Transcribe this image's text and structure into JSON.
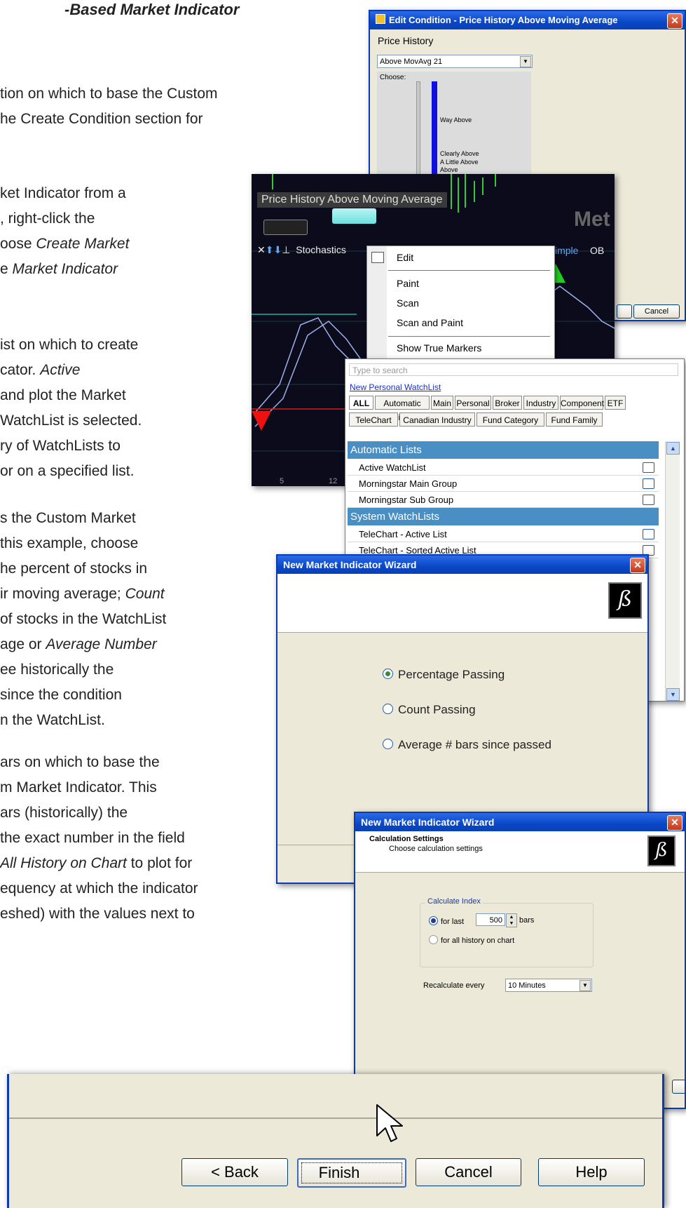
{
  "doc": {
    "heading": "-Based Market Indicator",
    "p1": [
      "tion on which to base the Custom",
      "he Create Condition section for"
    ],
    "p2": [
      {
        "a": "ket Indicator from a"
      },
      {
        "a": ", right-click the"
      },
      {
        "a": "oose ",
        "i": "Create Market"
      },
      {
        "a": "e ",
        "i": "Market Indicator"
      }
    ],
    "p3": [
      {
        "a": "ist on which to create"
      },
      {
        "a": "cator.  ",
        "i": "Active"
      },
      {
        "a": "and plot the Market"
      },
      {
        "a": "WatchList is selected."
      },
      {
        "a": "ry of WatchLists to"
      },
      {
        "a": "or on a specified list."
      }
    ],
    "p4": [
      {
        "a": "s the Custom Market"
      },
      {
        "a": " this example, choose"
      },
      {
        "a": "he percent of stocks in"
      },
      {
        "a": "ir moving average; ",
        "i": "Count"
      },
      {
        "a": "of stocks in the WatchList"
      },
      {
        "a": "age or ",
        "i": "Average Number"
      },
      {
        "a": "ee historically the"
      },
      {
        "a": "since the condition"
      },
      {
        "a": "n the WatchList."
      }
    ],
    "p5": [
      {
        "a": "ars on which to base the"
      },
      {
        "a": "m Market Indicator.  This"
      },
      {
        "a": "ars (historically) the"
      },
      {
        "a": " the exact number in the field"
      },
      {
        "i": "All History on Chart",
        "b": " to plot for"
      },
      {
        "a": "equency at which the indicator"
      },
      {
        "a": "eshed) with the values next to"
      }
    ]
  },
  "edit_condition": {
    "title": "Edit Condition - Price History Above Moving Average",
    "section": "Price History",
    "combo_value": "Above MovAvg 21",
    "choose": "Choose:",
    "levels": [
      "Way Above",
      "Clearly Above",
      "A Little Above",
      "Above"
    ],
    "cancel": "Cancel"
  },
  "chart": {
    "title": "Price History Above Moving Average",
    "watermark": "Met",
    "indicator": "Stochastics",
    "right_labels": [
      "imple",
      "OB"
    ],
    "bottom": [
      "5",
      "12"
    ]
  },
  "context_menu": {
    "items": [
      "Edit",
      "Paint",
      "Scan",
      "Scan and Paint",
      "Show True Markers"
    ]
  },
  "watchlist": {
    "search_placeholder": "Type to search",
    "new_link": "New Personal WatchList",
    "tabs_row1": [
      "ALL",
      "Automatic Lists",
      "Main",
      "Personal",
      "Broker",
      "Industry",
      "Component",
      "ETF"
    ],
    "tabs_row2": [
      "TeleChart",
      "Canadian Industry",
      "Fund Category",
      "Fund Family"
    ],
    "sections": [
      {
        "name": "Automatic Lists",
        "rows": [
          "Active WatchList",
          "Morningstar Main Group",
          "Morningstar Sub Group"
        ]
      },
      {
        "name": "System WatchLists",
        "rows": [
          "TeleChart - Active List",
          "TeleChart - Sorted Active List"
        ]
      }
    ]
  },
  "wizard1": {
    "title": "New Market Indicator Wizard",
    "options": [
      "Percentage Passing",
      "Count Passing",
      "Average # bars since passed"
    ],
    "selected": 0
  },
  "wizard2": {
    "title": "New Market Indicator Wizard",
    "header": "Calculation Settings",
    "subheader": "Choose calculation settings",
    "group": "Calculate Index",
    "for_last": "for last",
    "bars_value": "500",
    "bars": "bars",
    "all_history": "for all history on chart",
    "recalc_label": "Recalculate every",
    "recalc_value": "10 Minutes"
  },
  "buttons": {
    "back": "< Back",
    "finish": "Finish",
    "cancel": "Cancel",
    "help": "Help"
  }
}
